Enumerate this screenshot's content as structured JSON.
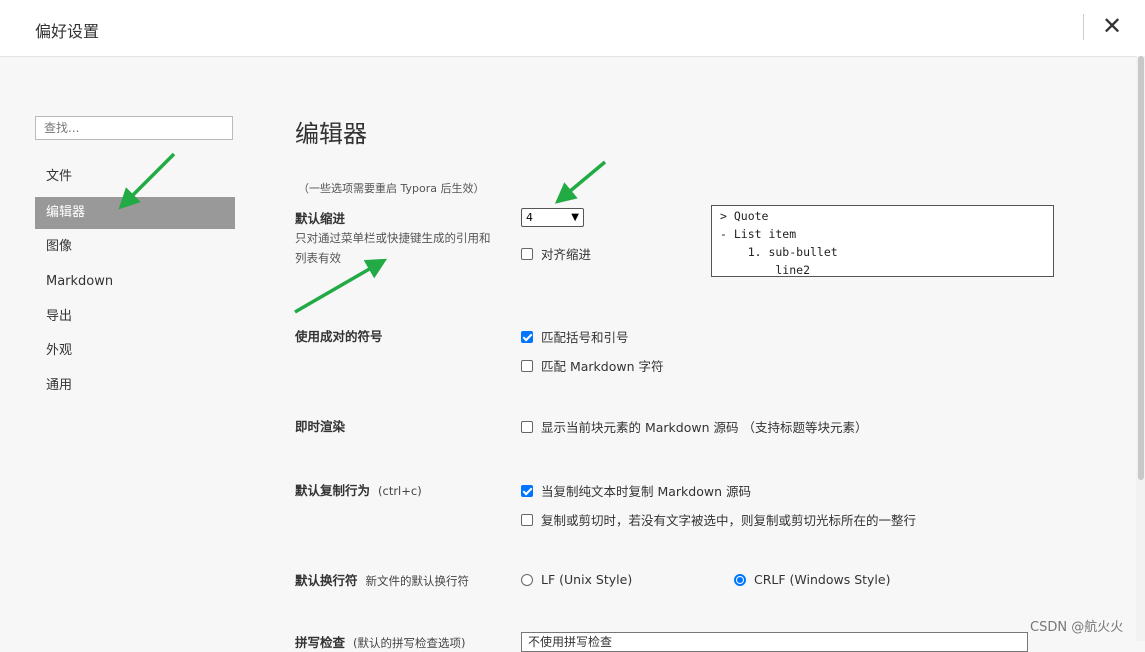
{
  "window": {
    "title": "偏好设置",
    "close_glyph": "✕"
  },
  "sidebar": {
    "search_placeholder": "查找...",
    "items": [
      {
        "label": "文件"
      },
      {
        "label": "编辑器",
        "active": true
      },
      {
        "label": "图像"
      },
      {
        "label": "Markdown"
      },
      {
        "label": "导出"
      },
      {
        "label": "外观"
      },
      {
        "label": "通用"
      }
    ]
  },
  "main": {
    "heading": "编辑器",
    "restart_note": "（一些选项需要重启 Typora 后生效）",
    "indent": {
      "label": "默认缩进",
      "desc": "只对通过菜单栏或快捷键生成的引用和列表有效",
      "select_value": "4",
      "align_label": "对齐缩进",
      "align_checked": false,
      "preview": "> Quote\n- List item\n    1. sub-bullet\n        line2"
    },
    "pairs": {
      "label": "使用成对的符号",
      "opt1": "匹配括号和引号",
      "opt1_checked": true,
      "opt2": "匹配 Markdown 字符",
      "opt2_checked": false
    },
    "live": {
      "label": "即时渲染",
      "opt1": "显示当前块元素的 Markdown 源码 （支持标题等块元素）",
      "opt1_checked": false
    },
    "copy": {
      "label": "默认复制行为",
      "sub": "(ctrl+c)",
      "opt1": "当复制纯文本时复制 Markdown 源码",
      "opt1_checked": true,
      "opt2": "复制或剪切时，若没有文字被选中，则复制或剪切光标所在的一整行",
      "opt2_checked": false
    },
    "newline": {
      "label": "默认换行符",
      "sub": "新文件的默认换行符",
      "lf": "LF (Unix Style)",
      "lf_checked": false,
      "crlf": "CRLF (Windows Style)",
      "crlf_checked": true
    },
    "spell": {
      "label": "拼写检查",
      "sub": "(默认的拼写检查选项)",
      "select_value": "不使用拼写检查"
    }
  },
  "watermark": "CSDN @航火火",
  "colors": {
    "accent": "#0075ff",
    "active_nav": "#999999",
    "annotation_arrow": "#22aa44"
  }
}
